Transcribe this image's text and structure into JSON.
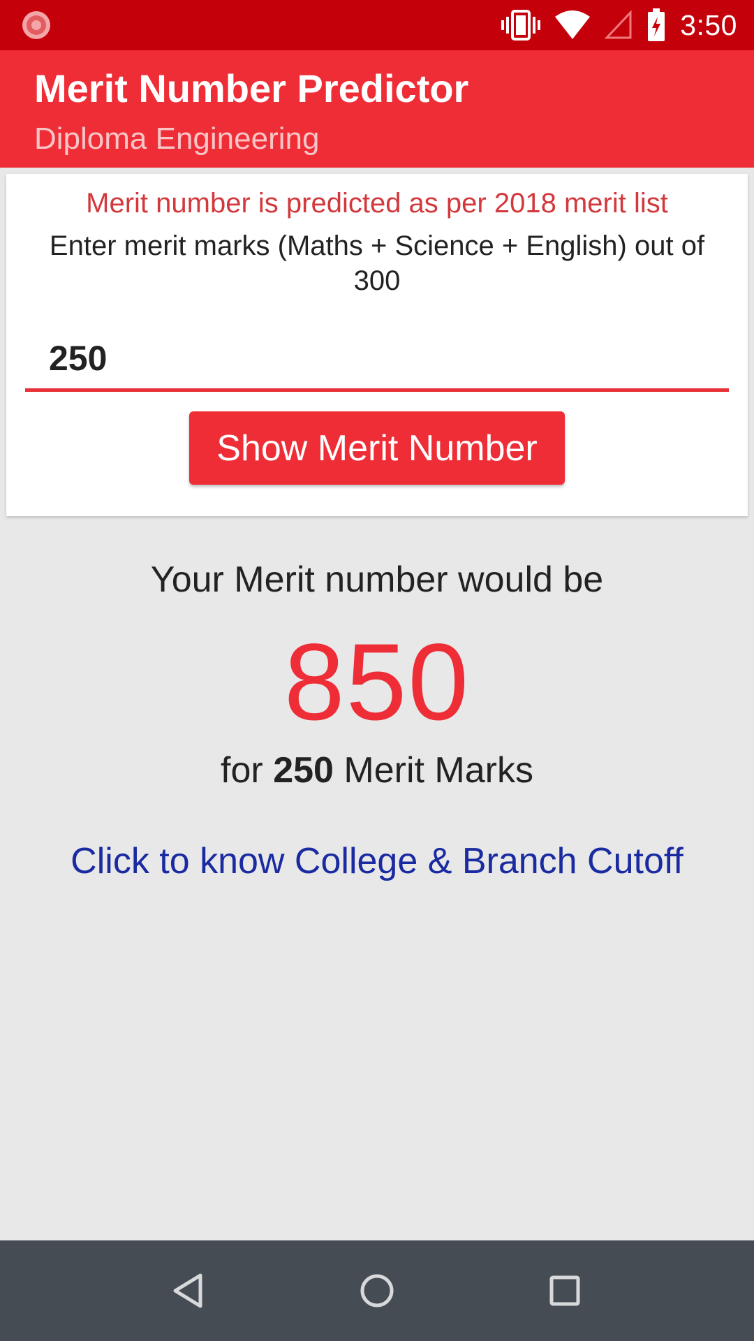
{
  "status_bar": {
    "time": "3:50",
    "icons": [
      "app-notification-icon",
      "vibrate-icon",
      "wifi-icon",
      "signal-icon",
      "battery-charging-icon"
    ],
    "color": "#c4000a"
  },
  "app_bar": {
    "title": "Merit Number Predictor",
    "subtitle": "Diploma Engineering",
    "color": "#ee2d36"
  },
  "form": {
    "notice": "Merit number is predicted as per 2018 merit list",
    "instruction": "Enter merit marks (Maths + Science + English) out of 300",
    "marks_value": "250",
    "button_label": "Show Merit Number"
  },
  "result": {
    "heading": "Your Merit number would be",
    "merit_number": "850",
    "for_prefix": "for ",
    "marks": "250",
    "for_suffix": " Merit Marks",
    "link_text": "Click to know College & Branch Cutoff",
    "number_color": "#ee2d36",
    "link_color": "#1a2aa0"
  },
  "nav_bar": {
    "icons": [
      "back-icon",
      "home-icon",
      "recent-apps-icon"
    ]
  }
}
